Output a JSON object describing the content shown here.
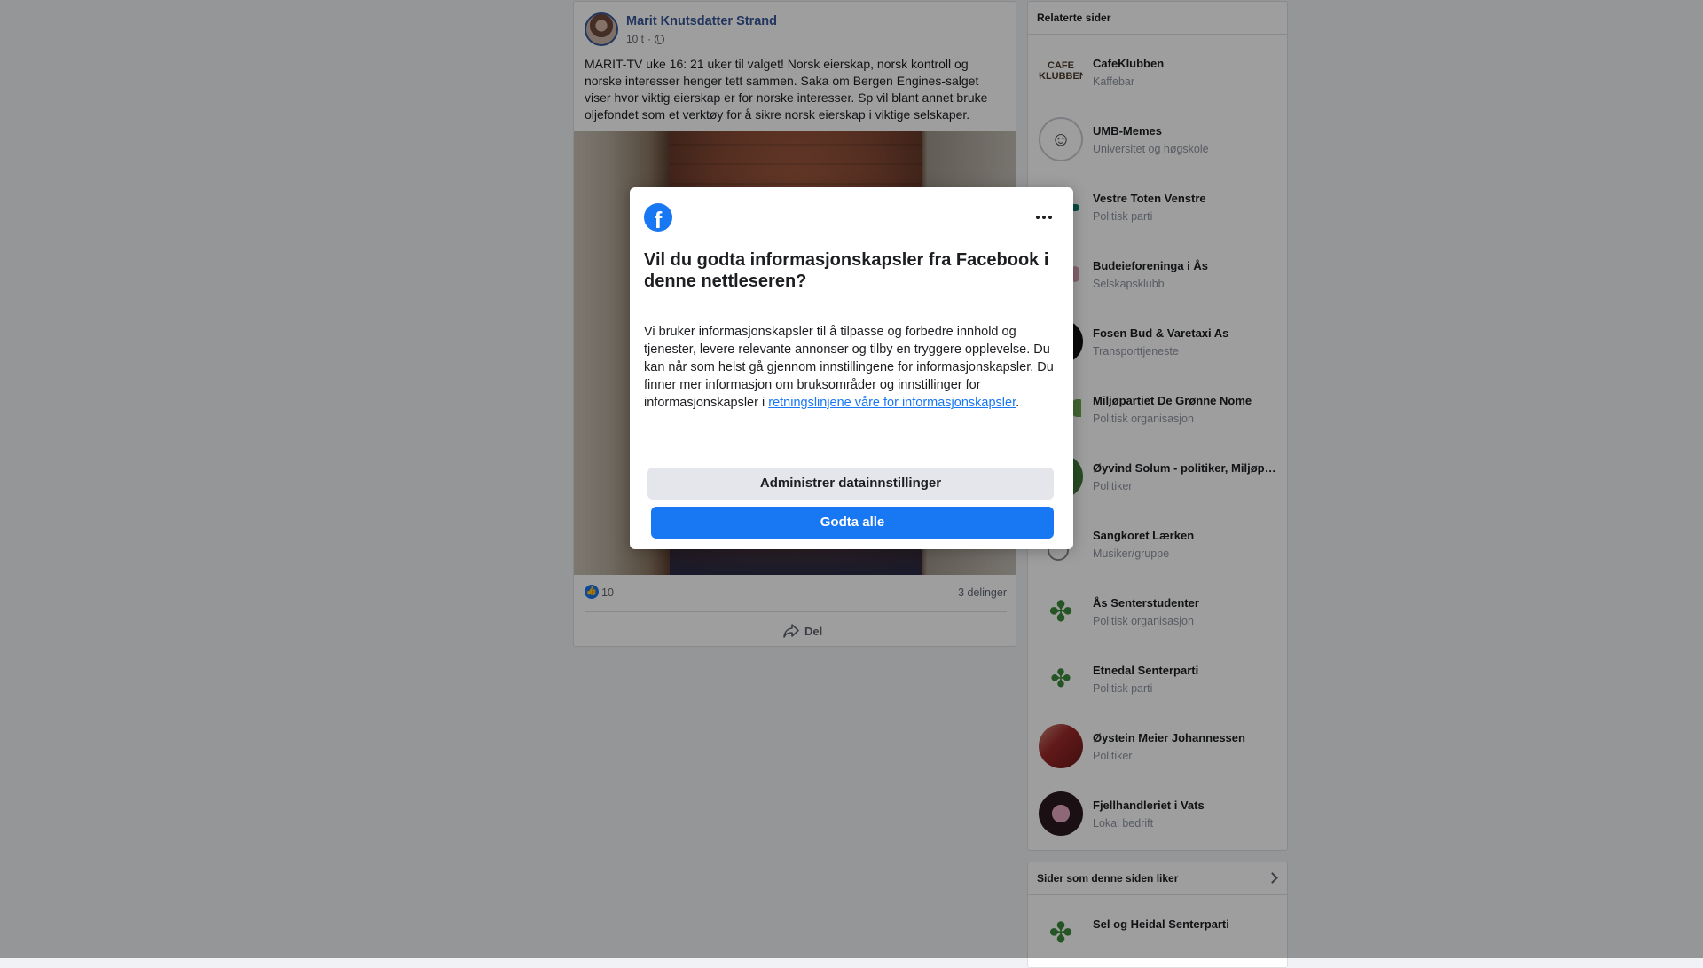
{
  "post": {
    "author": "Marit Knutsdatter Strand",
    "time": "10 t",
    "separator": "·",
    "text": "MARIT-TV uke 16: 21 uker til valget! Norsk eierskap, norsk kontroll og norske interesser henger tett sammen. Saka om Bergen Engines-salget viser hvor viktig eierskap er for norske interesser. Sp vil blant annet bruke oljefondet som et verktøy for å sikre norsk eierskap i viktige selskaper.",
    "likes": "10",
    "shares": "3 delinger",
    "share_label": "Del"
  },
  "related": {
    "title": "Relaterte sider",
    "items": [
      {
        "name": "CafeKlubben",
        "category": "Kaffebar"
      },
      {
        "name": "UMB-Memes",
        "category": "Universitet og høgskole"
      },
      {
        "name": "Vestre Toten Venstre",
        "category": "Politisk parti"
      },
      {
        "name": "Budeieforeninga i Ås",
        "category": "Selskapsklubb"
      },
      {
        "name": "Fosen Bud & Varetaxi As",
        "category": "Transporttjeneste"
      },
      {
        "name": "Miljøpartiet De Grønne Nome",
        "category": "Politisk organisasjon"
      },
      {
        "name": "Øyvind Solum - politiker, Miljøpa…",
        "category": "Politiker"
      },
      {
        "name": "Sangkoret Lærken",
        "category": "Musiker/gruppe"
      },
      {
        "name": "Ås Senterstudenter",
        "category": "Politisk organisasjon"
      },
      {
        "name": "Etnedal Senterparti",
        "category": "Politisk parti"
      },
      {
        "name": "Øystein Meier Johannessen",
        "category": "Politiker"
      },
      {
        "name": "Fjellhandleriet i Vats",
        "category": "Lokal bedrift"
      }
    ]
  },
  "liked": {
    "title": "Sider som denne siden liker",
    "items": [
      {
        "name": "Sel og Heidal Senterparti"
      }
    ]
  },
  "dialog": {
    "title": "Vil du godta informasjonskapsler fra Facebook i denne nettleseren?",
    "body_text": "Vi bruker informasjonskapsler til å tilpasse og forbedre innhold og tjenester, levere relevante annonser og tilby en tryggere opplevelse. Du kan når som helst gå gjennom innstillingene for informasjonskapsler. Du finner mer informasjon om bruksområder og innstillinger for informasjonskapsler i ",
    "link_text": "retningslinjene våre for informasjonskapsler",
    "body_end": ".",
    "manage_button": "Administrer datainnstillinger",
    "accept_button": "Godta alle"
  },
  "colors": {
    "facebook_blue": "#1877f2",
    "link_blue": "#385898",
    "background": "#f0f2f5",
    "overlay": "rgba(0,0,0,0.38)"
  }
}
